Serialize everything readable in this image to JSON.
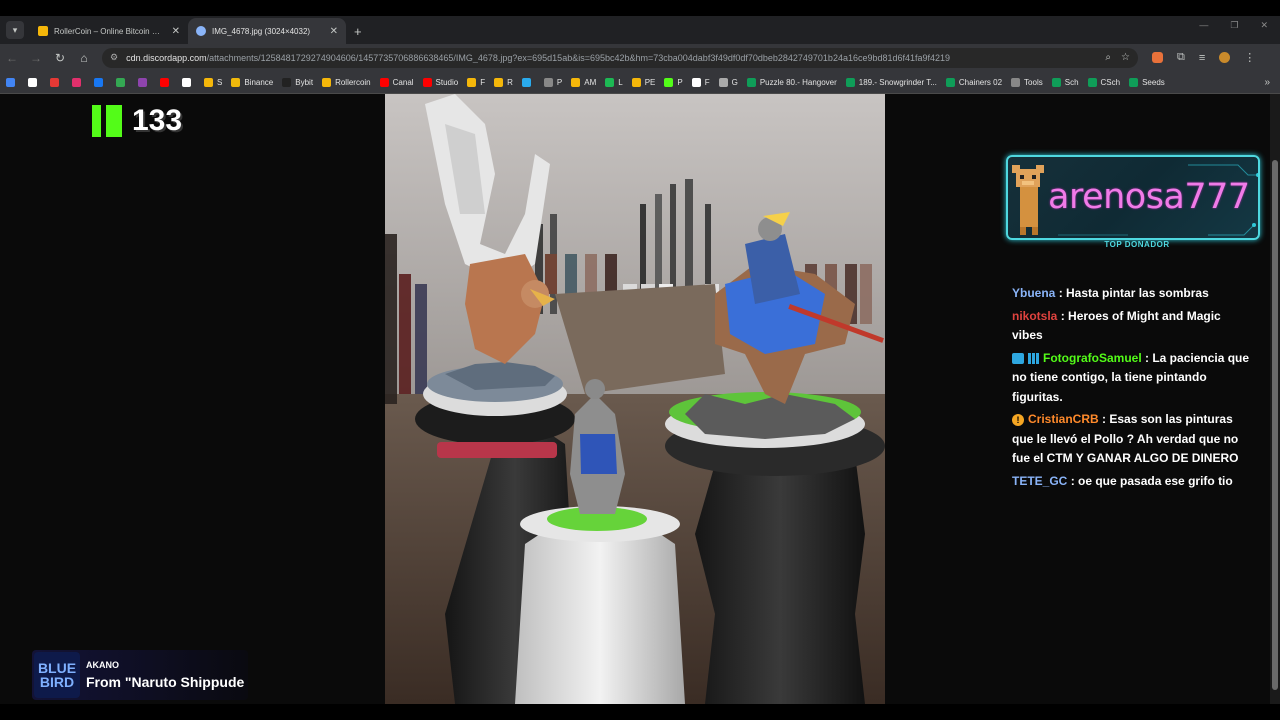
{
  "browser": {
    "tabs": [
      {
        "title": "RollerCoin – Online Bitcoin Mini",
        "active": false,
        "favicon_color": "#f5b70a"
      },
      {
        "title": "IMG_4678.jpg (3024×4032)",
        "active": true,
        "favicon_color": "#8ab4f8"
      }
    ],
    "new_tab": "+",
    "url_host": "cdn.discordapp.com",
    "url_path": "/attachments/1258481729274904606/1457735706886638465/IMG_4678.jpg?ex=695d15ab&is=695bc42b&hm=73cba004dabf3f49df0df70dbeb2842749701b24a16ce9bd81d6f41fa9f4219",
    "bookmarks": [
      {
        "label": "",
        "color": "#4285f4"
      },
      {
        "label": "",
        "color": "#ffffff"
      },
      {
        "label": "",
        "color": "#e53935"
      },
      {
        "label": "",
        "color": "#e1306c"
      },
      {
        "label": "",
        "color": "#1877f2"
      },
      {
        "label": "",
        "color": "#34a853"
      },
      {
        "label": "",
        "color": "#8e44ad"
      },
      {
        "label": "",
        "color": "#ff0000"
      },
      {
        "label": "",
        "color": "#ffffff"
      },
      {
        "label": "S",
        "color": "#f5b70a"
      },
      {
        "label": "Binance",
        "color": "#f0b90b"
      },
      {
        "label": "Bybit",
        "color": "#222222"
      },
      {
        "label": "Rollercoin",
        "color": "#f5b70a"
      },
      {
        "label": "Canal",
        "color": "#ff0000"
      },
      {
        "label": "Studio",
        "color": "#ff0000"
      },
      {
        "label": "F",
        "color": "#f5b70a"
      },
      {
        "label": "R",
        "color": "#f5b70a"
      },
      {
        "label": "",
        "color": "#2aabee"
      },
      {
        "label": "P",
        "color": "#888888"
      },
      {
        "label": "AM",
        "color": "#f5b70a"
      },
      {
        "label": "L",
        "color": "#1db954"
      },
      {
        "label": "PE",
        "color": "#f5b70a"
      },
      {
        "label": "P",
        "color": "#53fc18"
      },
      {
        "label": "F",
        "color": "#ffffff"
      },
      {
        "label": "G",
        "color": "#aaaaaa"
      },
      {
        "label": "Puzzle 80.- Hangover",
        "color": "#0f9d58"
      },
      {
        "label": "189.- Snowgrinder T...",
        "color": "#0f9d58"
      },
      {
        "label": "Chainers 02",
        "color": "#0f9d58"
      },
      {
        "label": "Tools",
        "color": "#888888"
      },
      {
        "label": "Sch",
        "color": "#0f9d58"
      },
      {
        "label": "CSch",
        "color": "#0f9d58"
      },
      {
        "label": "Seeds",
        "color": "#0f9d58"
      }
    ],
    "bookmarks_more": "»"
  },
  "stream": {
    "kick_count": "133",
    "donor": {
      "name": "arenosa777",
      "label": "TOP DONADOR"
    },
    "chat": [
      {
        "user": "Ybuena",
        "color": "#8ab4f8",
        "badges": [],
        "text": ": Hasta pintar las sombras"
      },
      {
        "user": "nikotsla",
        "color": "#e0433f",
        "badges": [],
        "text": ": Heroes of Might and Magic vibes"
      },
      {
        "user": "FotografoSamuel",
        "color": "#53fc18",
        "badges": [
          "tv",
          "grid"
        ],
        "text": ": La paciencia que no tiene contigo, la tiene pintando figuritas."
      },
      {
        "user": "CristianCRB",
        "color": "#ff8a2b",
        "badges": [
          "warn"
        ],
        "text": ": Esas son las pinturas que le llevó el Pollo ? Ah verdad que no fue el CTM Y GANAR ALGO DE DINERO"
      },
      {
        "user": "TETE_GC",
        "color": "#8ab4f8",
        "badges": [],
        "text": ": oe que pasada ese grifo tio"
      }
    ],
    "now_playing": {
      "art_line1": "BLUE",
      "art_line2": "BIRD",
      "artist": "AKANO",
      "title": "From \"Naruto Shippude"
    }
  }
}
